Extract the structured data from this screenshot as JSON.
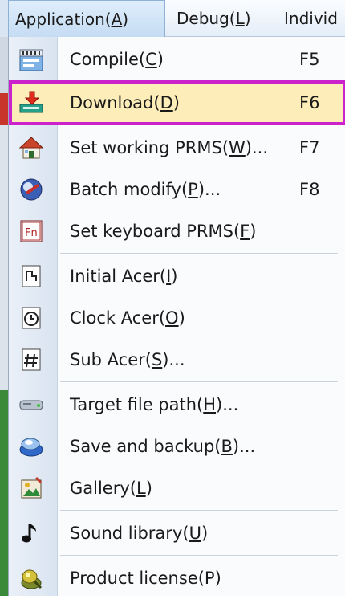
{
  "menubar": {
    "items": [
      {
        "text": "Application(",
        "key": "A",
        "tail": ")"
      },
      {
        "text": "Debug(",
        "key": "L",
        "tail": ")"
      },
      {
        "text": "Individ",
        "key": "",
        "tail": ""
      }
    ]
  },
  "menu": {
    "items": [
      {
        "pre": "Compile(",
        "key": "C",
        "post": ")",
        "shortcut": "F5",
        "icon": "compile-icon"
      },
      {
        "pre": "Download(",
        "key": "D",
        "post": ")",
        "shortcut": "F6",
        "icon": "download-icon",
        "highlighted": true
      },
      {
        "pre": "Set working PRMS(",
        "key": "W",
        "post": ")...",
        "shortcut": "F7",
        "icon": "house-icon"
      },
      {
        "pre": "Batch modify(",
        "key": "P",
        "post": ")...",
        "shortcut": "F8",
        "icon": "batch-modify-icon"
      },
      {
        "pre": "Set keyboard PRMS(",
        "key": "F",
        "post": ")",
        "shortcut": "",
        "icon": "keyboard-fn-icon"
      },
      {
        "pre": "Initial Acer(",
        "key": "I",
        "post": ")",
        "shortcut": "",
        "icon": "initial-doc-icon"
      },
      {
        "pre": "Clock Acer(",
        "key": "O",
        "post": ")",
        "shortcut": "",
        "icon": "clock-doc-icon"
      },
      {
        "pre": "Sub Acer(",
        "key": "S",
        "post": ")...",
        "shortcut": "",
        "icon": "hash-doc-icon"
      },
      {
        "pre": "Target file path(",
        "key": "H",
        "post": ")...",
        "shortcut": "",
        "icon": "drive-icon"
      },
      {
        "pre": "Save and backup(",
        "key": "B",
        "post": ")...",
        "shortcut": "",
        "icon": "save-backup-icon"
      },
      {
        "pre": "Gallery(",
        "key": "L",
        "post": ")",
        "shortcut": "",
        "icon": "gallery-icon"
      },
      {
        "pre": "Sound library(",
        "key": "U",
        "post": ")",
        "shortcut": "",
        "icon": "music-note-icon"
      },
      {
        "pre": "Product license(P)",
        "key": "",
        "post": "",
        "shortcut": "",
        "icon": "license-icon"
      }
    ]
  },
  "colors": {
    "highlight_fill": "#fdedb8",
    "highlight_border": "#cc22cc",
    "gutter": "#dce6f2"
  }
}
